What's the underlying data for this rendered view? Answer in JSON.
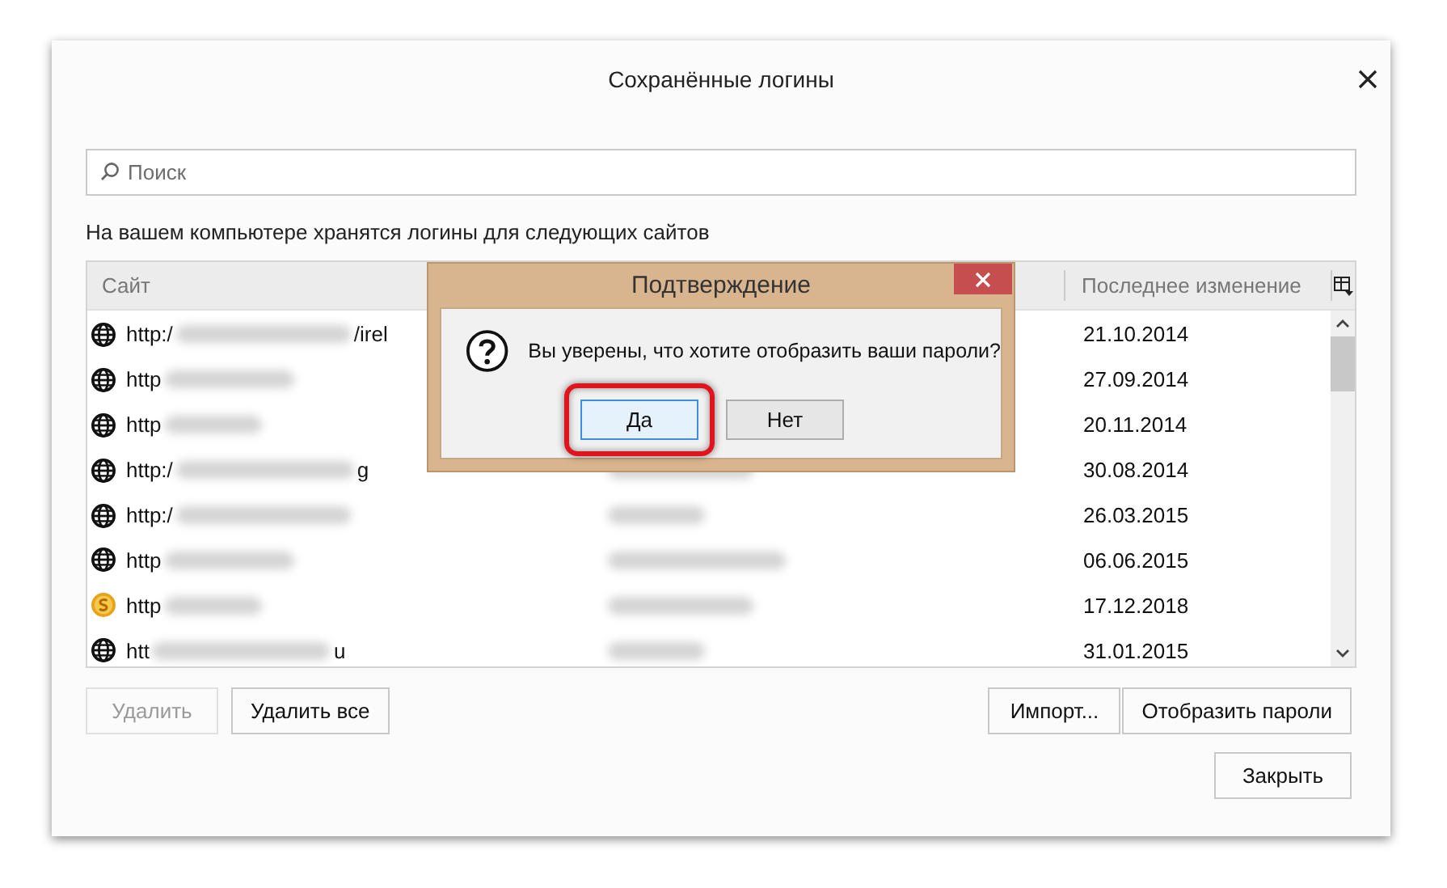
{
  "window": {
    "title": "Сохранённые логины"
  },
  "search": {
    "placeholder": "Поиск"
  },
  "intro": "На вашем компьютере хранятся логины для следующих сайтов",
  "table": {
    "columns": [
      "Сайт",
      "Последнее изменение"
    ],
    "rows": [
      {
        "kind": "globe",
        "site_start": "http:/",
        "site_end": "/irel",
        "date": "21.10.2014"
      },
      {
        "kind": "globe",
        "site_start": "http",
        "date": "27.09.2014"
      },
      {
        "kind": "globe",
        "site_start": "http",
        "date": "20.11.2014"
      },
      {
        "kind": "globe",
        "site_start": "http:/",
        "site_end": "g",
        "date": "30.08.2014"
      },
      {
        "kind": "globe",
        "site_start": "http:/",
        "date": "26.03.2015"
      },
      {
        "kind": "globe",
        "site_start": "http",
        "date": "06.06.2015"
      },
      {
        "kind": "coin",
        "site_start": "http",
        "date": "17.12.2018"
      },
      {
        "kind": "globe",
        "site_start": "htt",
        "site_end": "u",
        "date": "31.01.2015"
      }
    ]
  },
  "left_buttons": [
    {
      "label": "Удалить",
      "disabled": true
    },
    {
      "label": "Удалить все",
      "disabled": false
    }
  ],
  "right_buttons": [
    {
      "label": "Импорт...",
      "disabled": false
    },
    {
      "label": "Отобразить пароли",
      "disabled": false
    }
  ],
  "close_button": {
    "label": "Закрыть"
  },
  "dialog": {
    "title": "Подтверждение",
    "message": "Вы уверены, что хотите отобразить ваши пароли?",
    "buttons": [
      {
        "label": "Да",
        "focused": true,
        "highlighted": true
      },
      {
        "label": "Нет",
        "focused": false,
        "highlighted": false
      }
    ]
  }
}
